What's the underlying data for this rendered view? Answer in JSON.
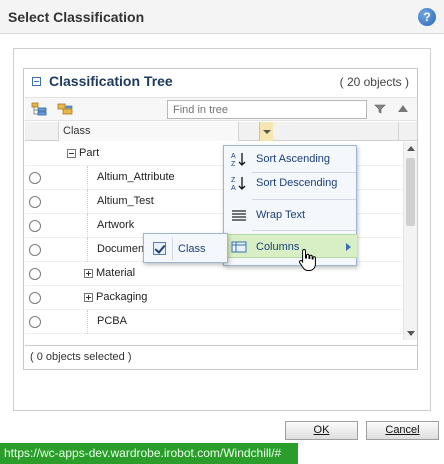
{
  "dialog": {
    "title": "Select Classification"
  },
  "panel": {
    "title": "Classification Tree",
    "count": "( 20 objects )"
  },
  "toolbar": {
    "find_placeholder": "Find in tree"
  },
  "columns": {
    "class_header": "Class"
  },
  "tree": {
    "rows": [
      {
        "label": "Part",
        "type": "folder-open",
        "radio": false
      },
      {
        "label": "Altium_Attribute",
        "type": "leaf",
        "radio": true
      },
      {
        "label": "Altium_Test",
        "type": "leaf",
        "radio": true
      },
      {
        "label": "Artwork",
        "type": "leaf",
        "radio": true
      },
      {
        "label": "Document",
        "type": "leaf",
        "radio": true
      },
      {
        "label": "Material",
        "type": "folder-closed",
        "radio": true
      },
      {
        "label": "Packaging",
        "type": "folder-closed",
        "radio": true
      },
      {
        "label": "PCBA",
        "type": "leaf",
        "radio": true
      }
    ]
  },
  "status": {
    "selected": "( 0 objects selected )"
  },
  "menu": {
    "items": [
      {
        "label": "Sort Ascending",
        "icon": "sort-ascending-icon"
      },
      {
        "label": "Sort Descending",
        "icon": "sort-descending-icon"
      },
      {
        "label": "Wrap Text",
        "icon": "wrap-text-icon"
      },
      {
        "label": "Columns",
        "icon": "columns-icon",
        "highlighted": true
      }
    ],
    "submenu": {
      "label": "Class",
      "checked": true
    }
  },
  "buttons": {
    "ok": "OK",
    "cancel": "Cancel"
  },
  "statusbar": {
    "url": "https://wc-apps-dev.wardrobe.irobot.com/Windchill/#"
  },
  "colors": {
    "menu_highlight": "#d8efc6",
    "url_bar": "#2a9d2a",
    "title_text": "#1e3a5f"
  }
}
